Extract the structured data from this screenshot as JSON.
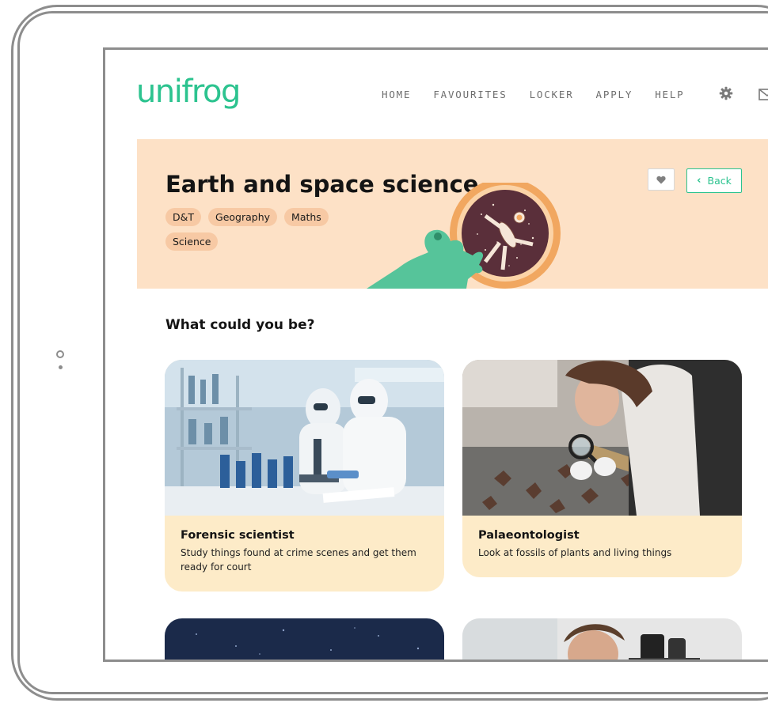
{
  "app": {
    "logo": "unifrog"
  },
  "nav": {
    "items": [
      {
        "label": "HOME"
      },
      {
        "label": "FAVOURITES"
      },
      {
        "label": "LOCKER"
      },
      {
        "label": "APPLY"
      },
      {
        "label": "HELP"
      }
    ],
    "settings_icon": "gear-icon",
    "messages_icon": "mail-icon"
  },
  "hero": {
    "title": "Earth and space science",
    "tags": [
      {
        "label": "D&T"
      },
      {
        "label": "Geography"
      },
      {
        "label": "Maths"
      },
      {
        "label": "Science"
      }
    ],
    "favourite_icon": "heart-icon",
    "back_label": "Back"
  },
  "section": {
    "title": "What could you be?"
  },
  "careers": [
    {
      "title": "Forensic scientist",
      "description": "Study things found at crime scenes and get them ready for court"
    },
    {
      "title": "Palaeontologist",
      "description": "Look at fossils of plants and living things"
    }
  ],
  "colors": {
    "brand": "#2cc38f",
    "hero_bg": "#fde1c6",
    "tag_bg": "#f7c9a4",
    "card_bg": "#fdebc8",
    "frame": "#8d8d8d"
  }
}
